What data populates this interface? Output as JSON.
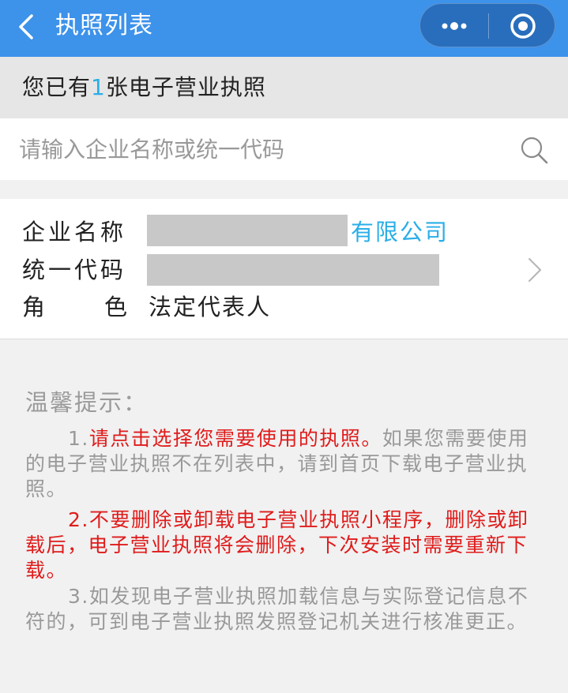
{
  "header": {
    "title": "执照列表",
    "back_icon": "chevron-left-icon",
    "more_icon": "more-dots-icon",
    "close_icon": "target-circle-icon",
    "bg_color": "#3d92ea"
  },
  "banner": {
    "prefix": "您已有",
    "count": "1",
    "suffix": "张电子营业执照",
    "count_color": "#2aaee8"
  },
  "search": {
    "placeholder": "请输入企业名称或统一代码",
    "value": "",
    "icon": "search-icon"
  },
  "license_card": {
    "name_label": "企业名称",
    "name_suffix": "有限公司",
    "code_label": "统一代码",
    "role_label_1": "角",
    "role_label_2": "色",
    "role_value": "法定代表人",
    "chevron_icon": "chevron-right-icon"
  },
  "tips": {
    "title": "温馨提示：",
    "tip1_prefix": "1.",
    "tip1_red": "请点击选择您需要使用的执照。",
    "tip1_rest": "如果您需要使用的电子营业执照不在列表中，请到首页下载电子营业执照。",
    "tip2": "2.不要删除或卸载电子营业执照小程序，删除或卸载后，电子营业执照将会删除，下次安装时需要重新下载。",
    "tip3": "3.如发现电子营业执照加载信息与实际登记信息不符的，可到电子营业执照发照登记机关进行核准更正。",
    "warning_color": "#e01b1b"
  }
}
